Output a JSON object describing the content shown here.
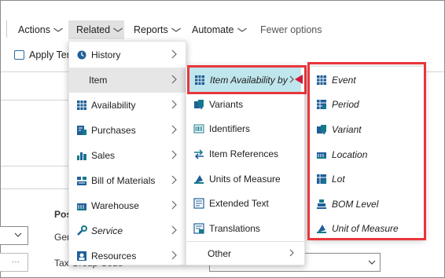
{
  "commandbar": {
    "actions": "Actions",
    "related": "Related",
    "reports": "Reports",
    "automate": "Automate",
    "fewer_options": "Fewer options"
  },
  "background": {
    "apply_template": "Apply Ten",
    "posting_heading": "Pos",
    "gen_label": "Ger",
    "tax_group_label": "Tax Group Code",
    "dots": "···"
  },
  "related_menu": {
    "items": [
      {
        "label": "History",
        "icon": "history-icon"
      },
      {
        "label": "Item",
        "icon": ""
      },
      {
        "label": "Availability",
        "icon": "availability-icon"
      },
      {
        "label": "Purchases",
        "icon": "purchases-icon"
      },
      {
        "label": "Sales",
        "icon": "sales-icon"
      },
      {
        "label": "Bill of Materials",
        "icon": "bill-of-materials-icon"
      },
      {
        "label": "Warehouse",
        "icon": "warehouse-icon"
      },
      {
        "label": "Service",
        "icon": "service-icon"
      },
      {
        "label": "Resources",
        "icon": "resources-icon"
      }
    ]
  },
  "item_menu": {
    "items": [
      {
        "label": "Item Availability by",
        "icon": "availability-grid-icon"
      },
      {
        "label": "Variants",
        "icon": "variants-icon"
      },
      {
        "label": "Identifiers",
        "icon": "barcode-icon"
      },
      {
        "label": "Item References",
        "icon": "swap-arrows-icon"
      },
      {
        "label": "Units of Measure",
        "icon": "units-of-measure-icon"
      },
      {
        "label": "Extended Text",
        "icon": "extended-text-icon"
      },
      {
        "label": "Translations",
        "icon": "translations-icon"
      },
      {
        "label": "Other",
        "icon": ""
      }
    ]
  },
  "availability_menu": {
    "items": [
      {
        "label": "Event",
        "icon": "calendar-grid-icon"
      },
      {
        "label": "Period",
        "icon": "period-icon"
      },
      {
        "label": "Variant",
        "icon": "variant-icon"
      },
      {
        "label": "Location",
        "icon": "location-icon"
      },
      {
        "label": "Lot",
        "icon": "lot-icon"
      },
      {
        "label": "BOM Level",
        "icon": "bom-level-icon"
      },
      {
        "label": "Unit of Measure",
        "icon": "unit-of-measure-icon"
      }
    ]
  },
  "colors": {
    "highlight": "#bfe6ec",
    "callout": "#e8363c",
    "icon_teal": "#137a8a",
    "icon_blue": "#1f5f99"
  }
}
